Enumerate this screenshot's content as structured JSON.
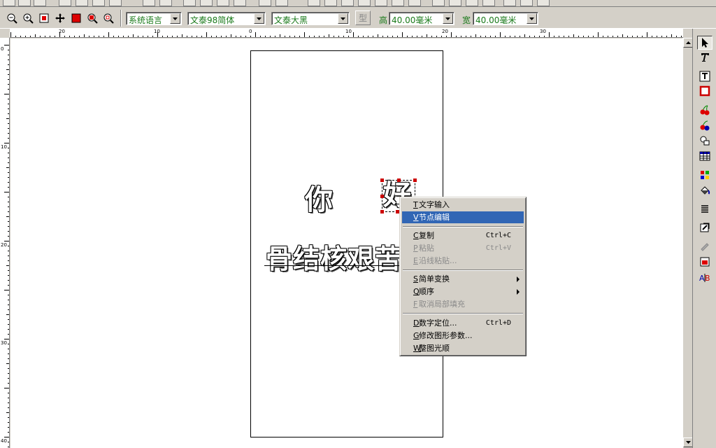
{
  "toolbar": {
    "language_combo": "系统语言",
    "font_cn_combo": "文泰98简体",
    "font_en_combo": "文泰大黑",
    "style_button": "型",
    "height_label": "高",
    "height_value": "40.00毫米",
    "width_label": "宽",
    "width_value": "40.00毫米"
  },
  "ruler": {
    "h_labels": [
      "20",
      "10",
      "0",
      "10",
      "20",
      "30"
    ],
    "v_labels": [
      "0",
      "10",
      "20",
      "30",
      "40"
    ]
  },
  "canvas": {
    "char_ni": "你",
    "char_hao": "好",
    "text_row": "骨结核艰苦"
  },
  "context_menu": {
    "items": [
      {
        "key": "T",
        "label": "文字输入",
        "shortcut": ""
      },
      {
        "key": "V",
        "label": "节点编辑",
        "shortcut": ""
      },
      {
        "key": "C",
        "label": "复制",
        "shortcut": "Ctrl+C"
      },
      {
        "key": "P",
        "label": "粘贴",
        "shortcut": "Ctrl+V"
      },
      {
        "key": "E",
        "label": "沿线粘贴...",
        "shortcut": ""
      },
      {
        "key": "S",
        "label": "简单变换",
        "shortcut": ""
      },
      {
        "key": "Q",
        "label": "顺序",
        "shortcut": ""
      },
      {
        "key": "F",
        "label": "取消局部填充",
        "shortcut": ""
      },
      {
        "key": "D",
        "label": "数字定位...",
        "shortcut": "Ctrl+D"
      },
      {
        "key": "G",
        "label": "修改图形参数...",
        "shortcut": ""
      },
      {
        "key": "W",
        "label": "整图光顺",
        "shortcut": ""
      }
    ]
  },
  "colors": {
    "menu_highlight": "#3166b5",
    "toolbar_bg": "#d4d0c8",
    "combo_text": "#1a7a1a",
    "handle_red": "#cc0000"
  }
}
